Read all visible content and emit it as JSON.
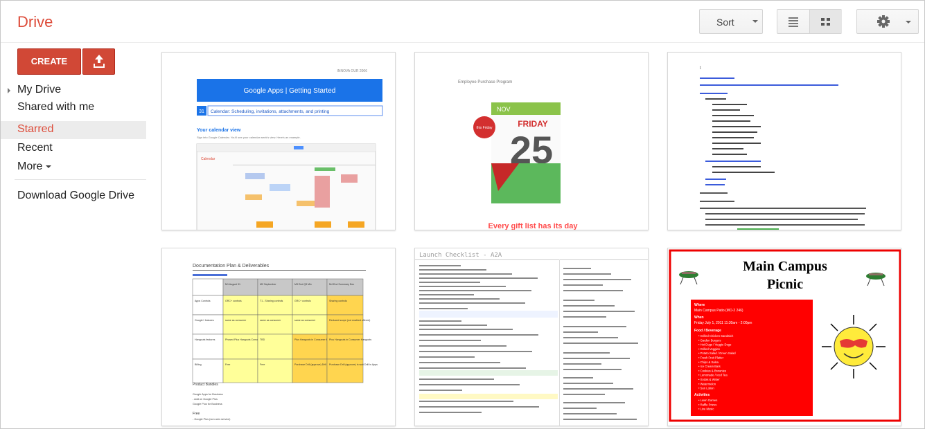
{
  "app": {
    "title": "Drive"
  },
  "toolbar": {
    "sort_label": "Sort"
  },
  "sidebar": {
    "create_label": "CREATE",
    "items": [
      {
        "label": "My Drive"
      },
      {
        "label": "Shared with me"
      },
      {
        "label": "Starred",
        "active": true
      },
      {
        "label": "Recent"
      },
      {
        "label": "More"
      },
      {
        "label": "Download Google Drive"
      }
    ]
  },
  "colors": {
    "brand": "#dd4b39",
    "create": "#d14836",
    "docs_blue": "#1a73e8",
    "flyer_red": "#ff0000"
  },
  "files": [
    {
      "kind": "doc",
      "header_right": "INNOVA OUR 2006",
      "banner": "Google Apps  |  Getting Started",
      "calendar_badge": "31",
      "line": "Calendar: Scheduling, invitations, attachments, and printing",
      "heading": "Your calendar view",
      "subtext": "Sign into Google Calendar. You'll see your calendar week's view. Here's an example.",
      "app_label": "Calendar"
    },
    {
      "kind": "promo",
      "top_text": "Employee Purchase Program",
      "month": "NOV",
      "badge": "this Friday",
      "day_name": "FRIDAY",
      "day_number": "25",
      "footer": "Every gift list has its day"
    },
    {
      "kind": "text-doc",
      "badge": "t"
    },
    {
      "kind": "doc-table",
      "title": "Documentation Plan & Deliverables",
      "columns": [
        "",
        "M1 August 31",
        "M2 September",
        "M3 End Q3 Mix",
        "M4 End Summary Dec"
      ],
      "rows": [
        [
          "Apps Controls",
          "GRC+ controls",
          "T1 - Sharing controls",
          "GRC+ controls",
          "Sharing controls"
        ],
        [
          "Google+ features",
          "same as consumer",
          "same as consumer",
          "same as consumer",
          "Reduced scope (not enabled offered)"
        ],
        [
          "Hangouts features",
          "Phased Plus Hangouts Consumer Hangouts",
          "TBD",
          "Plus Hangouts in Consumer Hangouts",
          "Plus Hangouts in Consumer Hangouts"
        ],
        [
          "Billing",
          "Free",
          "Free",
          "Purchase Drill (approve) Drill in Apps",
          "Purchase Drill (approve) in wait Drill in Apps"
        ]
      ],
      "product_title": "Product Bundles",
      "product_lines": [
        "Google Apps for Business",
        "- Add on Google Plus",
        "Google Plus for Business"
      ],
      "free_title": "Free",
      "free_lines": [
        "- Google Plus (non ares service)"
      ]
    },
    {
      "kind": "checklist",
      "title": "Launch Checklist - A2A"
    },
    {
      "kind": "flyer",
      "title_line1": "Main Campus",
      "title_line2": "Picnic",
      "where_label": "Where",
      "where_text": "Main Campus Patio (MO-2 246)",
      "when_label": "When",
      "when_text": "Friday July 1, 2011 11:30am - 2:00pm",
      "menu_label": "Food / Beverage",
      "menu": [
        "Grilled Chicken Sandwich",
        "Garden Burgers",
        "Hot Dogs / Veggie Dogs",
        "Grilled Veggies",
        "Potato Salad / Green Salad",
        "Fresh Fruit Platter",
        "Chips & Salsa",
        "Ice Cream Bars",
        "Cookies & Brownies",
        "Lemonade / Iced Tea",
        "Sodas & Water",
        "Watermelon",
        "Sun Lotion"
      ],
      "more_label": "Activities",
      "more": [
        "Lawn Games",
        "Raffle Prizes",
        "Live Music"
      ]
    }
  ]
}
